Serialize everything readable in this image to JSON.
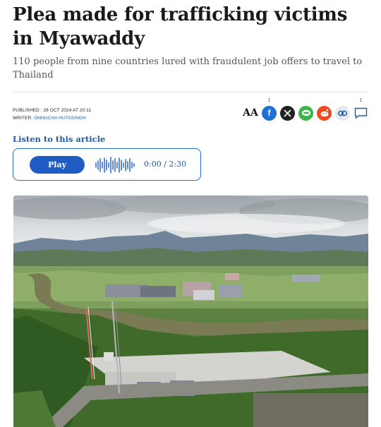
{
  "article": {
    "headline": "Plea made for trafficking victims in Myawaddy",
    "subheadline": "110 people from nine countries lured with fraudulent job offers to travel to Thailand",
    "published_label": "PUBLISHED :",
    "published_value": "26 OCT 2024 AT 20:11",
    "writer_label": "WRITER:",
    "writer_value": "ONNUCHA HUTASINGH"
  },
  "share": {
    "font_size_glyph": "AA",
    "facebook_count": "1",
    "comment_count": "1",
    "icons": [
      "text-size-icon",
      "facebook-icon",
      "x-icon",
      "line-icon",
      "reddit-icon",
      "link-icon",
      "comment-icon"
    ],
    "colors": {
      "facebook": "#1f6fd8",
      "x": "#222222",
      "line": "#3ab54a",
      "reddit": "#f04a1c",
      "accent": "#1f5aa6"
    }
  },
  "audio": {
    "listen_label": "Listen to this article",
    "play_label": "Play",
    "current_time": "0:00",
    "separator": "/",
    "duration": "2:30"
  },
  "photo": {
    "subject": "aerial-landscape-river-compound-icon"
  }
}
